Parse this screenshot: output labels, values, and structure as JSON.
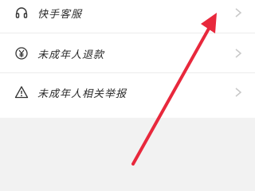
{
  "menu": {
    "items": [
      {
        "label": "快手客服",
        "icon": "headset-icon"
      },
      {
        "label": "未成年人退款",
        "icon": "yen-coin-icon"
      },
      {
        "label": "未成年人相关举报",
        "icon": "warning-icon"
      }
    ]
  },
  "colors": {
    "background": "#f2f2f2",
    "card": "#ffffff",
    "text": "#2b2b2b",
    "chevron": "#c8c8c8",
    "annotation_arrow": "#e8283c"
  }
}
